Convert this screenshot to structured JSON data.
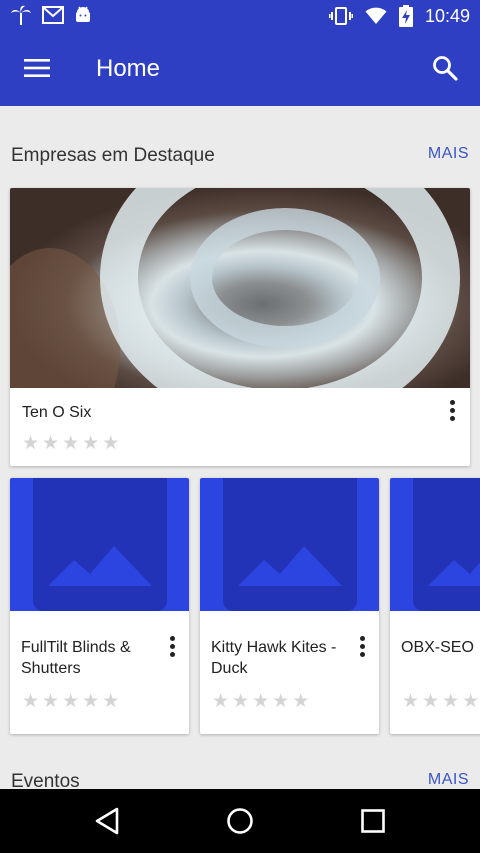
{
  "status_bar": {
    "time": "10:49",
    "left_icons": [
      "palm-tree-icon",
      "gmail-icon",
      "android-icon"
    ],
    "right_icons": [
      "vibrate-icon",
      "wifi-icon",
      "battery-charging-icon"
    ]
  },
  "app_bar": {
    "title": "Home",
    "menu_icon": "hamburger-menu-icon",
    "search_icon": "search-icon",
    "color": "#2f3fc3"
  },
  "sections": {
    "featured": {
      "title": "Empresas em Destaque",
      "more_label": "MAIS"
    },
    "events": {
      "title": "Eventos",
      "more_label": "MAIS"
    }
  },
  "featured_card": {
    "name": "Ten O Six",
    "rating": 0,
    "max_rating": 5
  },
  "business_cards": [
    {
      "name": "FullTilt Blinds & Shutters",
      "rating": 0
    },
    {
      "name": "Kitty Hawk Kites - Duck",
      "rating": 0
    },
    {
      "name": "OBX-SEO",
      "rating": 0
    }
  ],
  "stars": [
    "★",
    "★",
    "★",
    "★",
    "★"
  ],
  "colors": {
    "primary": "#2f3fc3",
    "accent_link": "#3a55c4",
    "placeholder_bg": "#2d45e0",
    "placeholder_inner": "#2233b8"
  },
  "nav_bar": {
    "icons": [
      "back-icon",
      "home-icon",
      "recents-icon"
    ]
  }
}
